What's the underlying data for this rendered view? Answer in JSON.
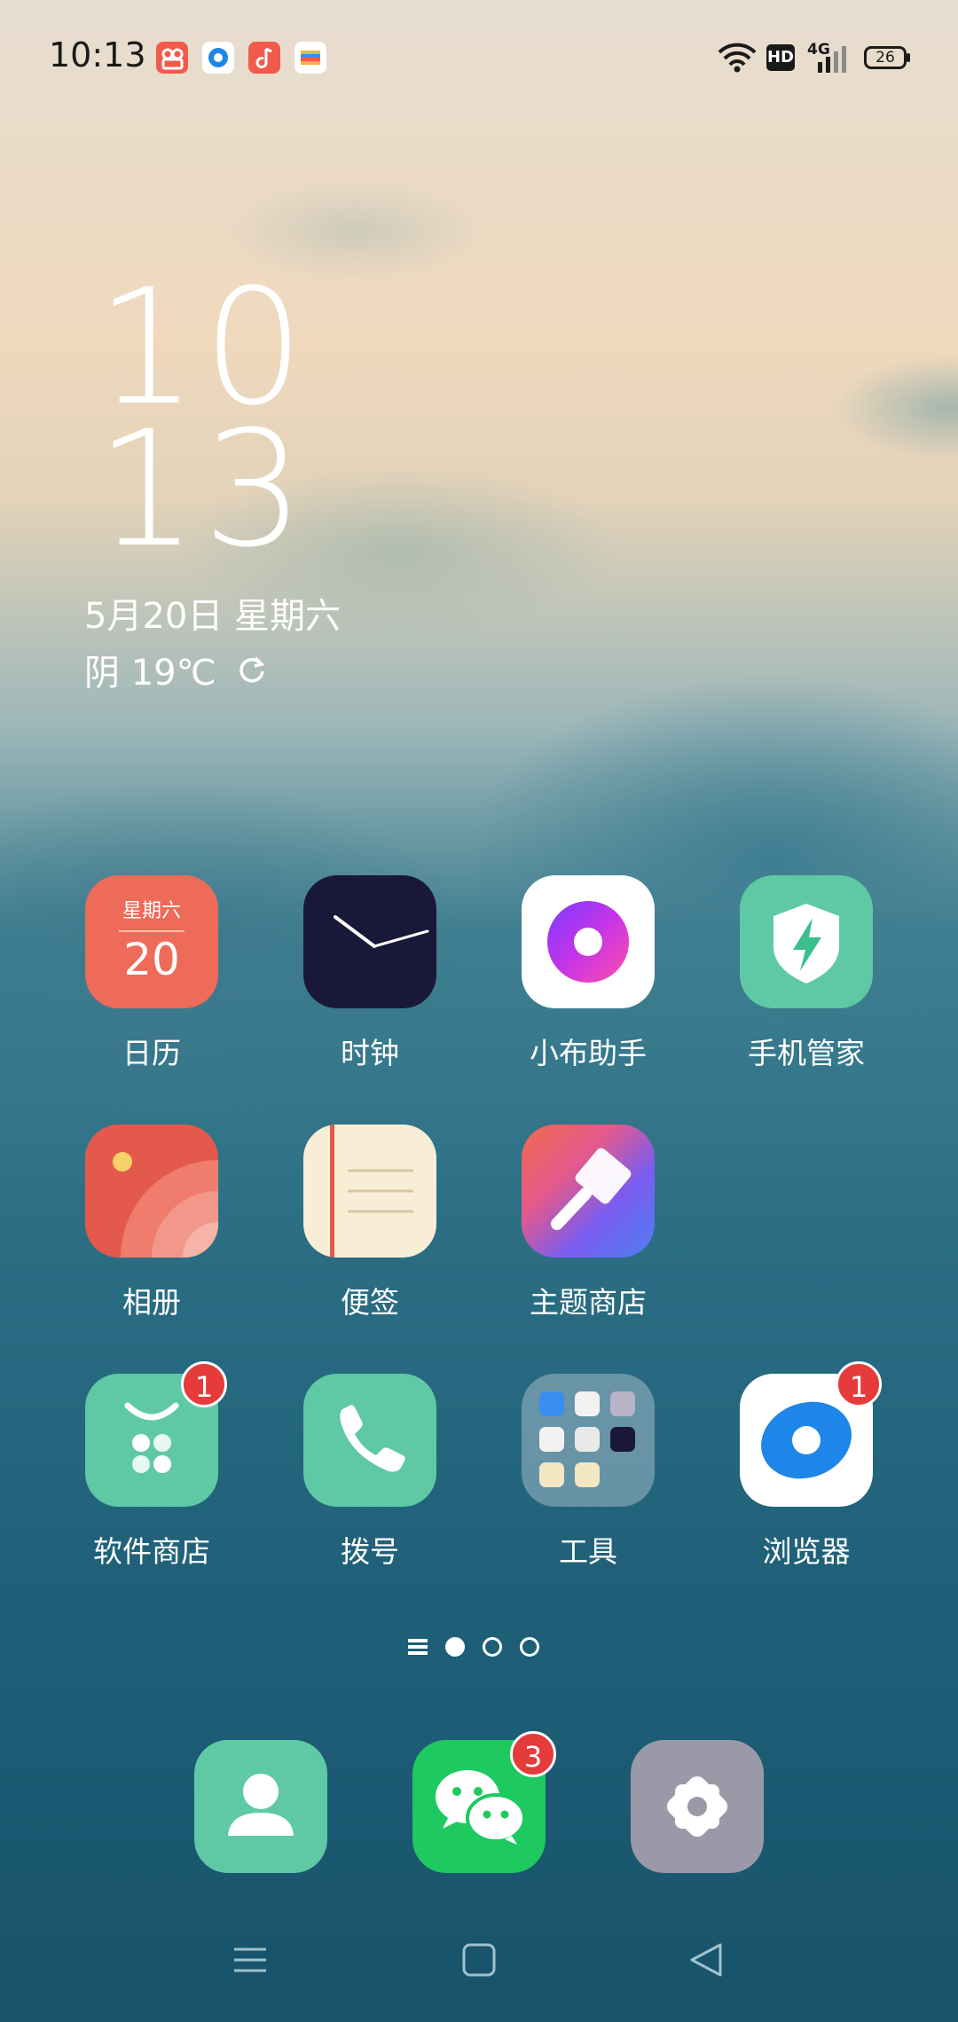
{
  "status_bar": {
    "time": "10:13",
    "hd_label": "HD",
    "network": "4G",
    "battery": "26"
  },
  "clock": {
    "hour": "10",
    "minute": "13",
    "date": "5月20日 星期六",
    "weather": "阴 19℃"
  },
  "apps": [
    {
      "label": "日历",
      "calendar_weekday": "星期六",
      "calendar_day": "20"
    },
    {
      "label": "时钟"
    },
    {
      "label": "小布助手"
    },
    {
      "label": "手机管家"
    },
    {
      "label": "相册"
    },
    {
      "label": "便签"
    },
    {
      "label": "主题商店"
    },
    {
      "label": "软件商店",
      "badge": "1"
    },
    {
      "label": "拨号"
    },
    {
      "label": "工具"
    },
    {
      "label": "浏览器",
      "badge": "1"
    }
  ],
  "dock": [
    {
      "name": "contacts"
    },
    {
      "name": "wechat",
      "badge": "3"
    },
    {
      "name": "settings"
    }
  ],
  "page_indicator": {
    "pages": 3,
    "current": 1
  },
  "colors": {
    "badge": "#e53b3b",
    "mint": "#5fc9a6",
    "wechat": "#1ec960"
  }
}
